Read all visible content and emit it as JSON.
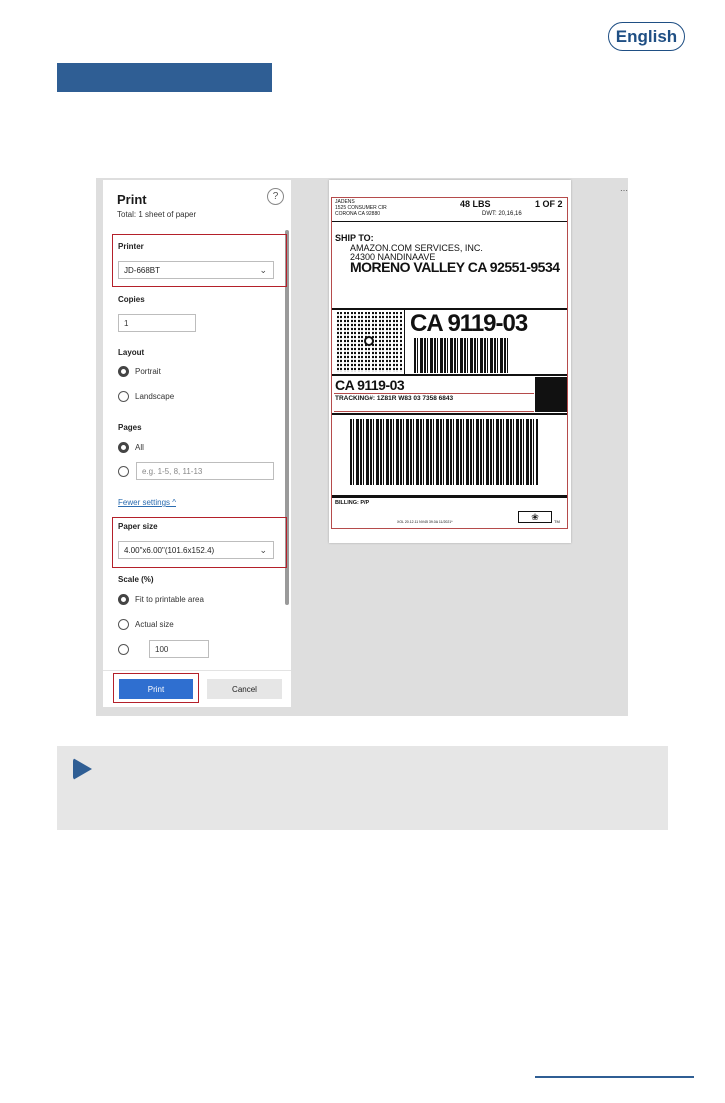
{
  "header": {
    "language_button": "English"
  },
  "print_dialog": {
    "title": "Print",
    "total": "Total: 1 sheet of paper",
    "help": "?",
    "printer": {
      "label": "Printer",
      "value": "JD-668BT"
    },
    "copies": {
      "label": "Copies",
      "value": "1"
    },
    "layout": {
      "label": "Layout",
      "options": [
        "Portrait",
        "Landscape"
      ],
      "selected": "Portrait"
    },
    "pages": {
      "label": "Pages",
      "all": "All",
      "custom_placeholder": "e.g. 1-5, 8, 11-13"
    },
    "fewer_settings": "Fewer settings ^",
    "paper_size": {
      "label": "Paper size",
      "value": "4.00\"x6.00\"(101.6x152.4)"
    },
    "scale": {
      "label": "Scale (%)",
      "fit": "Fit to printable area",
      "actual": "Actual size",
      "custom_value": "100"
    },
    "buttons": {
      "print": "Print",
      "cancel": "Cancel"
    }
  },
  "label_preview": {
    "from_name": "JADENS",
    "from_street": "1525 CONSUMER CIR",
    "from_city": "CORONA CA 92880",
    "weight": "48 LBS",
    "count": "1 OF 2",
    "dwt": "DWT: 20,16,16",
    "ship_to_heading": "SHIP TO:",
    "ship_to_line1": "AMAZON.COM SERVICES, INC.",
    "ship_to_line2": "24300 NANDINAAVE",
    "ship_to_city": "MORENO VALLEY CA 92551-9534",
    "route_code": "CA 9119-03",
    "route_code_2": "CA 9119-03",
    "tracking": "TRACKING#: 1Z81R W83 03 7358 6843",
    "billing": "BILLING: P/P",
    "footer_code": "XOL 20.12.11        NV45 39.0A 11/2021*",
    "tm": "TM"
  },
  "colors": {
    "accent": "#2f5e94",
    "highlight": "#b4202a",
    "print_button": "#2f6fd0"
  }
}
